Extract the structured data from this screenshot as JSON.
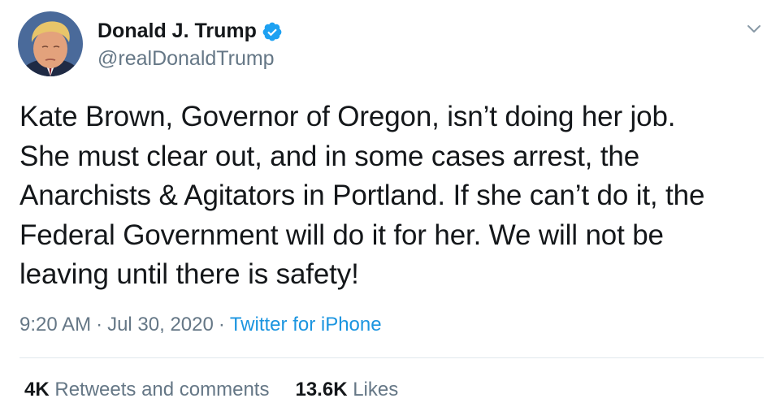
{
  "author": {
    "display_name": "Donald J. Trump",
    "handle": "@realDonaldTrump",
    "verified": true
  },
  "tweet": {
    "text": "Kate Brown, Governor of Oregon, isn’t doing her job.\nShe must clear out, and in some cases arrest, the\nAnarchists & Agitators in Portland. If she can’t do it, the\nFederal Government will do it for her. We will not be\nleaving until there is safety!",
    "time": "9:20 AM",
    "separator": "·",
    "date": "Jul 30, 2020",
    "source": "Twitter for iPhone"
  },
  "stats": {
    "retweets_count": "4K",
    "retweets_label": "Retweets and comments",
    "likes_count": "13.6K",
    "likes_label": "Likes"
  },
  "icons": {
    "verified": "verified-badge-icon",
    "menu": "chevron-down-icon"
  },
  "colors": {
    "accent": "#1b95e0",
    "verified": "#1da1f2",
    "secondary_text": "#657786",
    "primary_text": "#14171a",
    "divider": "#e1e8ed"
  }
}
